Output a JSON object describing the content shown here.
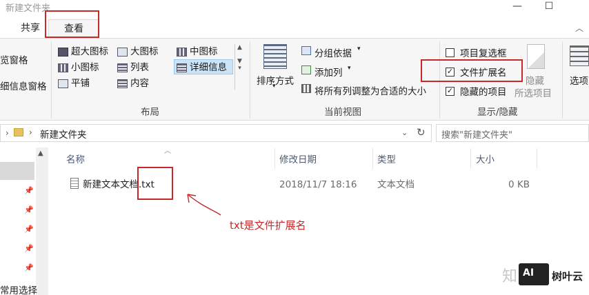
{
  "window": {
    "title": "新建文件夹",
    "controls": {
      "minimize": "—",
      "maximize": "☐"
    }
  },
  "ribbon_tabs": {
    "share": "共享",
    "view": "查看"
  },
  "pane_group": {
    "preview_pane": "览窗格",
    "details_pane": "细信息窗格"
  },
  "layout_group": {
    "label": "布局",
    "items": [
      "超大图标",
      "大图标",
      "中图标",
      "小图标",
      "列表",
      "详细信息",
      "平铺",
      "内容"
    ],
    "selected": "详细信息"
  },
  "current_view_group": {
    "label": "当前视图",
    "sort_by": "排序方式",
    "group_by": "分组依据",
    "add_column": "添加列",
    "fit_columns": "将所有列调整为合适的大小"
  },
  "show_hide_group": {
    "label": "显示/隐藏",
    "item_checkboxes": {
      "label": "项目复选框",
      "checked": false
    },
    "file_extensions": {
      "label": "文件扩展名",
      "checked": true
    },
    "hidden_items": {
      "label": "隐藏的项目",
      "checked": true
    },
    "hide_selected": "隐藏",
    "hide_selected_line2": "所选项目"
  },
  "options_group": {
    "label": "选项"
  },
  "address_bar": {
    "path": "新建文件夹",
    "search_placeholder": "搜索\"新建文件夹\""
  },
  "nav_pane": {
    "quick_access": "常用选择"
  },
  "file_list": {
    "columns": [
      "名称",
      "修改日期",
      "类型",
      "大小"
    ],
    "rows": [
      {
        "name": "新建文本文档.txt",
        "modified": "2018/11/7 18:16",
        "type": "文本文档",
        "size": "0 KB"
      }
    ]
  },
  "annotation": "txt是文件扩展名",
  "watermark": {
    "zh": "知",
    "ai": "AI",
    "text": "树叶云"
  },
  "colors": {
    "annotation_red": "#c62828",
    "selection_blue": "#cce4f7"
  },
  "icons": [
    "folder-icon",
    "text-file-icon",
    "refresh-icon",
    "search-icon",
    "pin-icon"
  ]
}
